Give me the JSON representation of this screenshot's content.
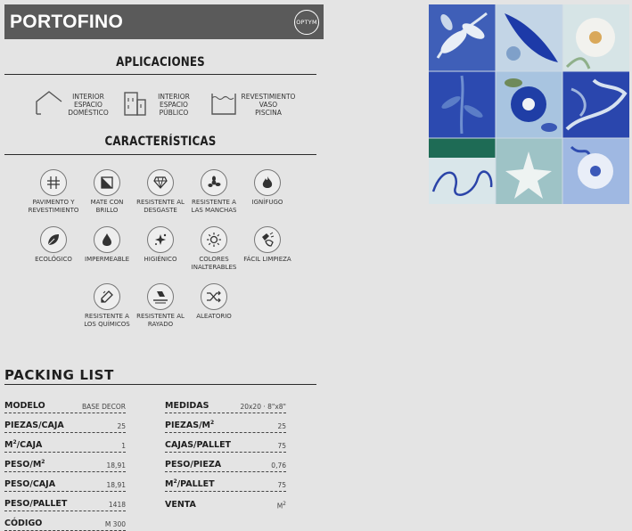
{
  "header": {
    "title": "PORTOFINO",
    "badge": "OPTYM"
  },
  "aplicaciones": {
    "title": "APLICACIONES",
    "items": [
      {
        "icon": "house-icon",
        "lines": [
          "INTERIOR",
          "ESPACIO",
          "DOMÉSTICO"
        ]
      },
      {
        "icon": "building-icon",
        "lines": [
          "INTERIOR",
          "ESPACIO",
          "PÚBLICO"
        ]
      },
      {
        "icon": "pool-icon",
        "lines": [
          "REVESTIMIENTO",
          "VASO",
          "PISCINA"
        ]
      }
    ]
  },
  "caracteristicas": {
    "title": "CARACTERÍSTICAS",
    "items": [
      {
        "icon": "floor-wall-icon",
        "lines": [
          "PAVIMENTO Y",
          "REVESTIMIENTO"
        ]
      },
      {
        "icon": "matte-gloss-icon",
        "lines": [
          "MATE CON",
          "BRILLO"
        ]
      },
      {
        "icon": "diamond-icon",
        "lines": [
          "RESISTENTE AL",
          "DESGASTE"
        ]
      },
      {
        "icon": "stain-icon",
        "lines": [
          "RESISTENTE A",
          "LAS MANCHAS"
        ]
      },
      {
        "icon": "flame-icon",
        "lines": [
          "IGNÍFUGO"
        ]
      },
      {
        "icon": "leaf-icon",
        "lines": [
          "ECOLÓGICO"
        ]
      },
      {
        "icon": "drop-icon",
        "lines": [
          "IMPERMEABLE"
        ]
      },
      {
        "icon": "sparkle-icon",
        "lines": [
          "HIGIÉNICO"
        ]
      },
      {
        "icon": "sun-icon",
        "lines": [
          "COLORES",
          "INALTERABLES"
        ]
      },
      {
        "icon": "cleaning-hand-icon",
        "lines": [
          "FÁCIL LIMPIEZA"
        ]
      },
      {
        "icon": "chemical-icon",
        "lines": [
          "RESISTENTE A",
          "LOS QUÍMICOS"
        ]
      },
      {
        "icon": "scratch-icon",
        "lines": [
          "RESISTENTE AL",
          "RAYADO"
        ]
      },
      {
        "icon": "shuffle-icon",
        "lines": [
          "ALEATORIO"
        ]
      }
    ]
  },
  "packing": {
    "title": "PACKING LIST",
    "left": [
      {
        "key": "MODELO",
        "value": "BASE DECOR"
      },
      {
        "key": "PIEZAS/CAJA",
        "value": "25"
      },
      {
        "key": "M",
        "sup": "2",
        "key_tail": "/CAJA",
        "value": "1"
      },
      {
        "key": "PESO/M",
        "sup": "2",
        "key_tail": "",
        "value": "18,91"
      },
      {
        "key": "PESO/CAJA",
        "value": "18,91"
      },
      {
        "key": "PESO/PALLET",
        "value": "1418"
      },
      {
        "key": "CÓDIGO",
        "value": "M 300"
      }
    ],
    "right": [
      {
        "key": "MEDIDAS",
        "value": "20x20 · 8\"x8\""
      },
      {
        "key": "PIEZAS/M",
        "sup": "2",
        "key_tail": "",
        "value": "25"
      },
      {
        "key": "CAJAS/PALLET",
        "value": "75"
      },
      {
        "key": "PESO/PIEZA",
        "value": "0,76"
      },
      {
        "key": "M",
        "sup": "2",
        "key_tail": "/PALLET",
        "value": "75"
      },
      {
        "key": "VENTA",
        "value": "M",
        "value_sup": "2"
      }
    ]
  },
  "colors": {
    "header_bg": "#5a5a5a",
    "page_bg": "#e4e4e4",
    "tile_blue": "#2b44a8",
    "tile_light": "#b9cfe0"
  }
}
